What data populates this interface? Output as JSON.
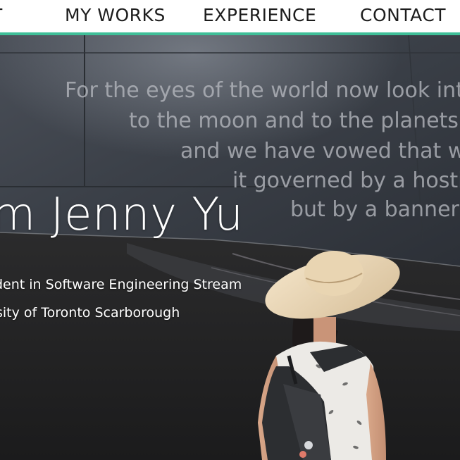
{
  "nav": {
    "items": [
      {
        "label": "T"
      },
      {
        "label": "MY WORKS"
      },
      {
        "label": "EXPERIENCE"
      },
      {
        "label": "CONTACT"
      }
    ],
    "accent_color": "#3fbf98"
  },
  "hero": {
    "title": "m Jenny Yu",
    "subtitle_line1": "dent in Software Engineering Stream",
    "subtitle_line2": "sity of Toronto Scarborough",
    "wall_inscription": [
      "For the eyes of the world now look int",
      "to the moon and to the planets b",
      "and we have vowed that w",
      "it governed by a hostil",
      "but by a banner o"
    ]
  }
}
